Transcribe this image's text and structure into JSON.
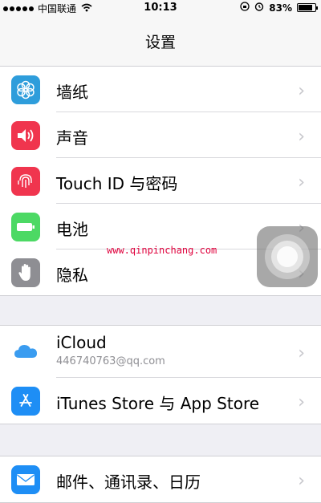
{
  "status_bar": {
    "carrier": "中国联通",
    "time": "10:13",
    "battery_percent": "83%",
    "battery_level": 0.83,
    "signal_bars_filled": 5
  },
  "nav": {
    "title": "设置"
  },
  "groups": [
    {
      "rows": [
        {
          "label": "墙纸",
          "icon": "wallpaper-icon",
          "color": "#2e9ddb"
        },
        {
          "label": "声音",
          "icon": "speaker-icon",
          "color": "#f0354e"
        },
        {
          "label": "Touch ID 与密码",
          "icon": "fingerprint-icon",
          "color": "#f0354e"
        },
        {
          "label": "电池",
          "icon": "battery-icon",
          "color": "#4cd964"
        },
        {
          "label": "隐私",
          "icon": "hand-icon",
          "color": "#8e8e93"
        }
      ]
    },
    {
      "rows": [
        {
          "label": "iCloud",
          "sublabel": "446740763@qq.com",
          "icon": "icloud-icon",
          "color": "#ffffff"
        },
        {
          "label": "iTunes Store 与 App Store",
          "icon": "app-store-icon",
          "color": "#1e8ef5"
        }
      ]
    },
    {
      "rows": [
        {
          "label": "邮件、通讯录、日历",
          "icon": "mail-icon",
          "color": "#1e8ef5"
        }
      ]
    }
  ],
  "watermark": "www.qinpinchang.com"
}
